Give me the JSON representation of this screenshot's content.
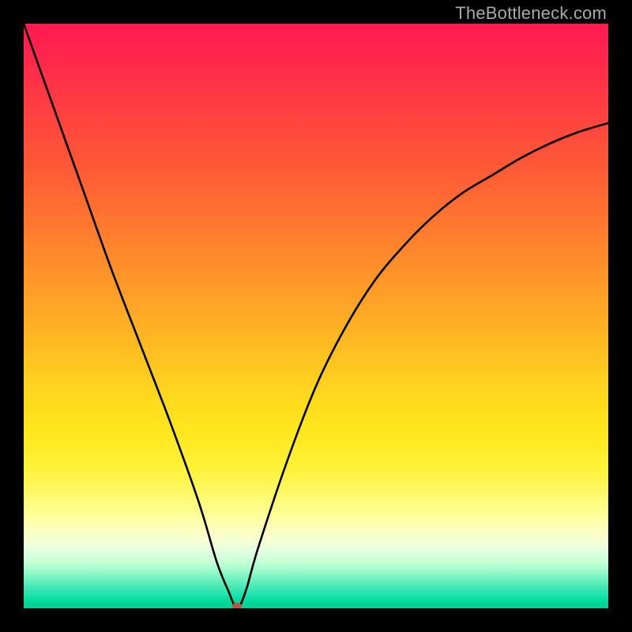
{
  "watermark": "TheBottleneck.com",
  "chart_data": {
    "type": "line",
    "title": "",
    "xlabel": "",
    "ylabel": "",
    "xlim": [
      0,
      100
    ],
    "ylim": [
      0,
      100
    ],
    "grid": false,
    "legend": false,
    "background_gradient": {
      "stops": [
        {
          "pos": 0,
          "color": "#ff1a52"
        },
        {
          "pos": 50,
          "color": "#ffbb22"
        },
        {
          "pos": 85,
          "color": "#feffa8"
        },
        {
          "pos": 100,
          "color": "#00d090"
        }
      ]
    },
    "series": [
      {
        "name": "bottleneck-curve",
        "color": "#000000",
        "x": [
          0,
          5,
          10,
          15,
          20,
          25,
          30,
          33,
          35,
          36.5,
          38,
          40,
          45,
          50,
          55,
          60,
          65,
          70,
          75,
          80,
          85,
          90,
          95,
          100
        ],
        "y": [
          100,
          86,
          72,
          58,
          45,
          32,
          18,
          8,
          3,
          0,
          3,
          10,
          25,
          38,
          48,
          56,
          62,
          67,
          71,
          74,
          77,
          79.5,
          81.5,
          83
        ]
      }
    ],
    "marker": {
      "name": "optimal-point",
      "x": 36.5,
      "y": 0,
      "color": "#c05040",
      "rx": 6,
      "ry": 4
    }
  }
}
